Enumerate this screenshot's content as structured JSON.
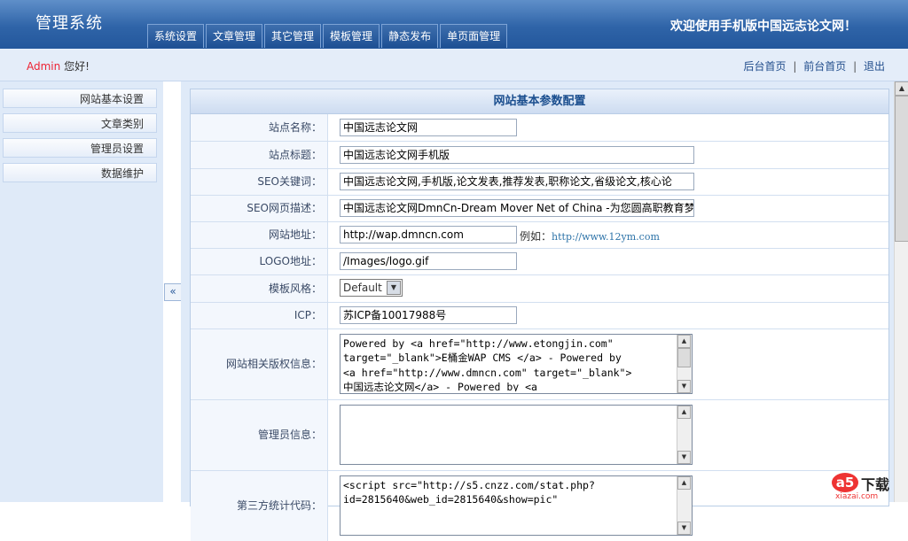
{
  "header": {
    "app_title": "管理系统",
    "welcome": "欢迎使用手机版中国远志论文网！",
    "nav": [
      "系统设置",
      "文章管理",
      "其它管理",
      "模板管理",
      "静态发布",
      "单页面管理"
    ]
  },
  "subbar": {
    "user": "Admin",
    "greeting": "您好!",
    "links": [
      "后台首页",
      "前台首页",
      "退出"
    ]
  },
  "sidebar": {
    "items": [
      "网站基本设置",
      "文章类别",
      "管理员设置",
      "数据维护"
    ],
    "toggle": "«"
  },
  "form": {
    "title": "网站基本参数配置",
    "site_name": {
      "label": "站点名称：",
      "value": "中国远志论文网"
    },
    "site_title": {
      "label": "站点标题：",
      "value": "中国远志论文网手机版"
    },
    "seo_keywords": {
      "label": "SEO关键词：",
      "value": "中国远志论文网,手机版,论文发表,推荐发表,职称论文,省级论文,核心论"
    },
    "seo_desc": {
      "label": "SEO网页描述：",
      "value": "中国远志论文网DmnCn-Dream Mover Net of China -为您圆高职教育梦"
    },
    "site_url": {
      "label": "网站地址：",
      "value": "http://wap.dmncn.com",
      "hint": "例如：",
      "example": "http://www.12ym.com"
    },
    "logo": {
      "label": "LOGO地址：",
      "value": "/Images/logo.gif"
    },
    "template": {
      "label": "模板风格：",
      "value": "Default"
    },
    "icp": {
      "label": "ICP：",
      "value": "苏ICP备10017988号"
    },
    "copyright": {
      "label": "网站相关版权信息：",
      "value": "Powered by <a href=\"http://www.etongjin.com\"\ntarget=\"_blank\">E桶金WAP CMS </a> - Powered by\n<a href=\"http://www.dmncn.com\" target=\"_blank\">\n中国远志论文网</a> - Powered by <a"
    },
    "admin_info": {
      "label": "管理员信息：",
      "value": ""
    },
    "stats": {
      "label": "第三方统计代码：",
      "value": "<script src=\"http://s5.cnzz.com/stat.php?\nid=2815640&web_id=2815640&show=pic\""
    }
  },
  "watermark": {
    "brand": "a5",
    "text": "下载",
    "site": "xiazai.com"
  }
}
